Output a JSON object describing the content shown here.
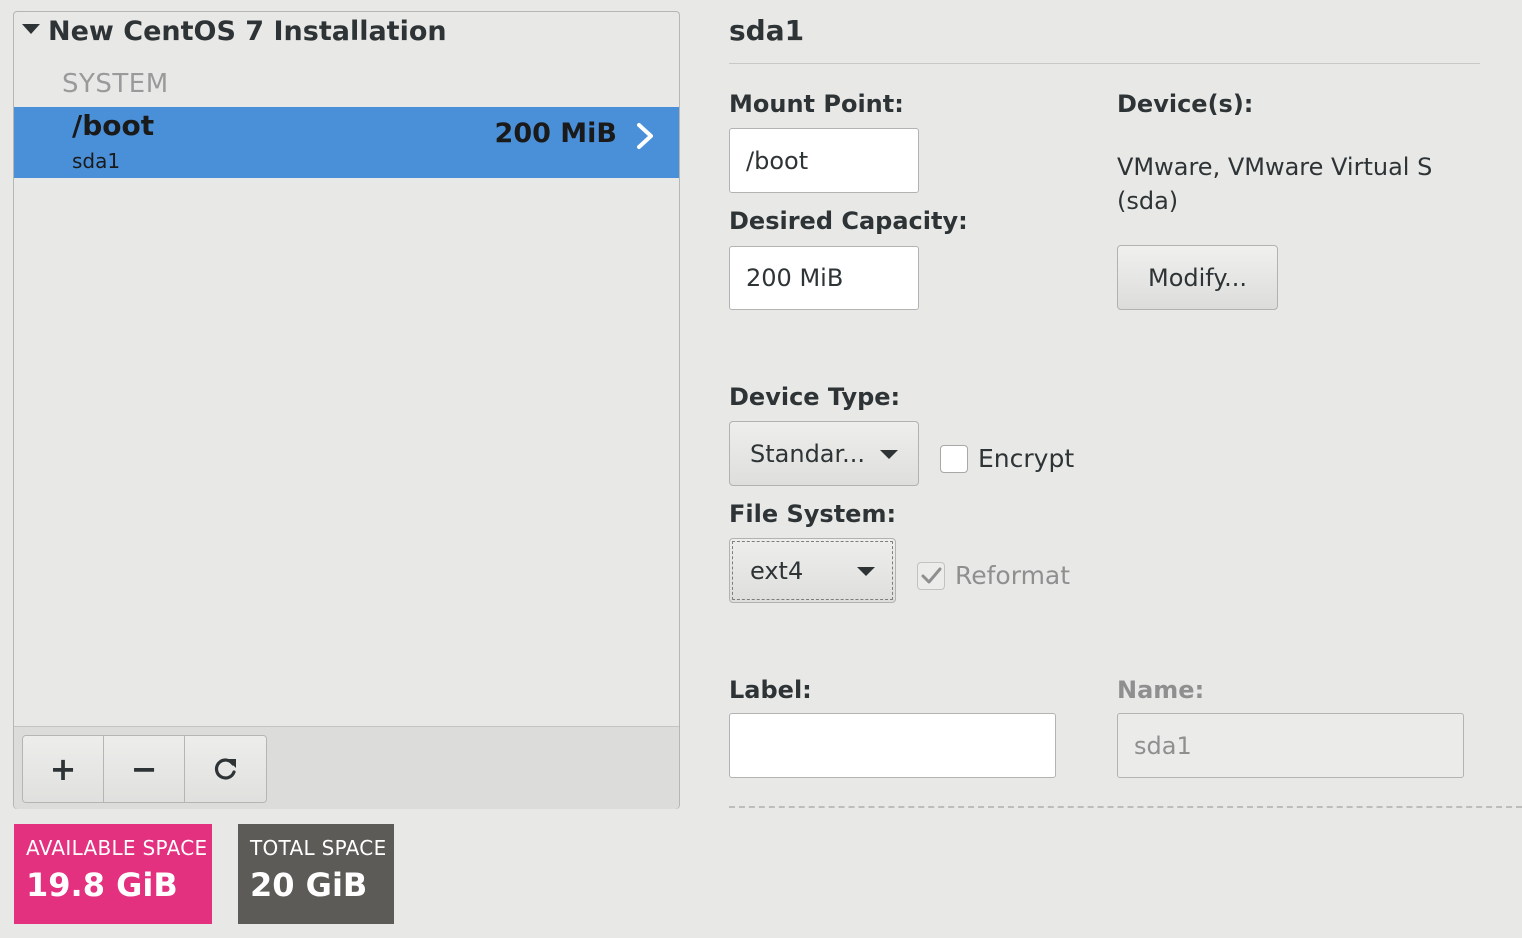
{
  "partitions_panel": {
    "installation_title": "New CentOS 7 Installation",
    "section_label": "SYSTEM",
    "selected_row": {
      "mount": "/boot",
      "device": "sda1",
      "size": "200 MiB"
    },
    "toolbar": {
      "add": "+",
      "remove": "−",
      "refresh": "⟳"
    }
  },
  "space": {
    "available_label": "AVAILABLE SPACE",
    "available_value": "19.8 GiB",
    "total_label": "TOTAL SPACE",
    "total_value": "20 GiB",
    "available_color": "#e3307f",
    "total_color": "#5c5b57"
  },
  "details": {
    "title": "sda1",
    "mount_point_label": "Mount Point:",
    "mount_point_value": "/boot",
    "desired_capacity_label": "Desired Capacity:",
    "desired_capacity_value": "200 MiB",
    "devices_label": "Device(s):",
    "devices_line1": "VMware, VMware Virtual S",
    "devices_line2": "(sda)",
    "modify_button": "Modify...",
    "device_type_label": "Device Type:",
    "device_type_value": "Standar...",
    "encrypt_label": "Encrypt",
    "encrypt_checked": false,
    "file_system_label": "File System:",
    "file_system_value": "ext4",
    "reformat_label": "Reformat",
    "reformat_checked": true,
    "label_label": "Label:",
    "label_value": "",
    "name_label": "Name:",
    "name_value": "sda1"
  },
  "colors": {
    "selection": "#4a90d9",
    "background": "#e8e8e7"
  }
}
